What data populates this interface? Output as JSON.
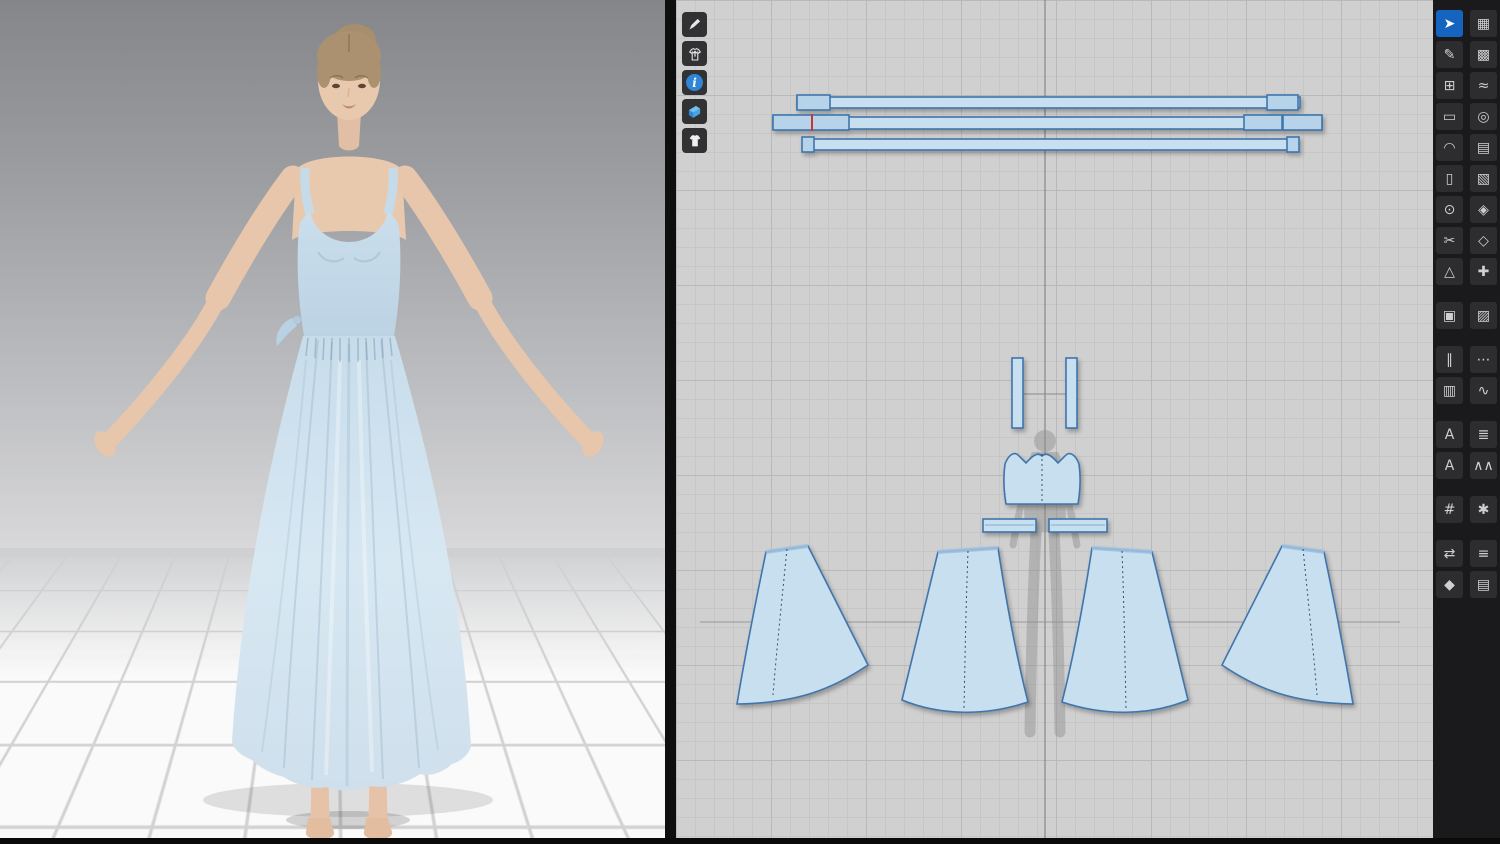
{
  "colors": {
    "accent_blue": "#2f86d6",
    "active_tool_bg": "#1565c0",
    "pattern_fill": "#c8dff0",
    "pattern_stroke": "#3f75ad",
    "panel_bg": "#d0d0d0",
    "toolbar_bg": "#1a1a1c",
    "tile_bg": "#2d2d2f",
    "dress_blue": "#cfe1ee",
    "skin_tone": "#e9c9ae"
  },
  "panel_2d": {
    "mini_toolbar": {
      "tools": [
        {
          "name": "stylus-tool",
          "glyph": "pen"
        },
        {
          "name": "reset-garment-tool",
          "glyph": "shirt-up-arrow"
        },
        {
          "name": "info",
          "glyph": "i"
        },
        {
          "name": "fabric-swatch",
          "glyph": "fabric"
        },
        {
          "name": "show-garment",
          "glyph": "shirt"
        }
      ]
    }
  },
  "right_toolbar": {
    "tools": [
      {
        "name": "select-tool",
        "glyph": "➤",
        "active": true
      },
      {
        "name": "sewing-machine-tool",
        "glyph": "▦",
        "active": false
      },
      {
        "name": "pen-tool",
        "glyph": "✎",
        "active": false
      },
      {
        "name": "auto-sew-tool",
        "glyph": "▩",
        "active": false
      },
      {
        "name": "edit-pattern-tool",
        "glyph": "⊞",
        "active": false
      },
      {
        "name": "iron-tool",
        "glyph": "≈",
        "active": false
      },
      {
        "name": "rectangle-pattern-tool",
        "glyph": "▭",
        "active": false
      },
      {
        "name": "zoom-tool",
        "glyph": "◎",
        "active": false
      },
      {
        "name": "curve-tool",
        "glyph": "◠",
        "active": false
      },
      {
        "name": "notes-tool",
        "glyph": "▤",
        "active": false
      },
      {
        "name": "dart-tool",
        "glyph": "▯",
        "active": false
      },
      {
        "name": "press-tool",
        "glyph": "▧",
        "active": false
      },
      {
        "name": "add-point-tool",
        "glyph": "⊙",
        "active": false
      },
      {
        "name": "garment-tool",
        "glyph": "◈",
        "active": false
      },
      {
        "name": "scissors-tool",
        "glyph": "✂",
        "active": false
      },
      {
        "name": "fit-garment-tool",
        "glyph": "◇",
        "active": false
      },
      {
        "name": "trace-tool",
        "glyph": "△",
        "active": false
      },
      {
        "name": "pin-tool",
        "glyph": "✚",
        "active": false
      },
      {
        "name": "uv-map-tool",
        "glyph": "▣",
        "active": false
      },
      {
        "name": "texture-tool",
        "glyph": "▨",
        "active": false
      },
      {
        "name": "internal-line-tool",
        "glyph": "∥",
        "active": false
      },
      {
        "name": "stitch-dash-tool",
        "glyph": "⋯",
        "active": false
      },
      {
        "name": "measure-tool",
        "glyph": "▥",
        "active": false
      },
      {
        "name": "wave-tool",
        "glyph": "∿",
        "active": false
      },
      {
        "name": "text-tool",
        "glyph": "A",
        "active": false
      },
      {
        "name": "spec-list-tool",
        "glyph": "≣",
        "active": false
      },
      {
        "name": "text-style-tool",
        "glyph": "A",
        "active": false
      },
      {
        "name": "zigzag-tool",
        "glyph": "∧∧",
        "active": false
      },
      {
        "name": "grading-tool",
        "glyph": "#",
        "active": false
      },
      {
        "name": "figure-tool",
        "glyph": "✱",
        "active": false
      },
      {
        "name": "sync-tool",
        "glyph": "⇄",
        "active": false
      },
      {
        "name": "stack-tool",
        "glyph": "≡",
        "active": false
      },
      {
        "name": "select-garment-tool",
        "glyph": "◆",
        "active": false
      },
      {
        "name": "layers-tool",
        "glyph": "▤",
        "active": false
      }
    ]
  }
}
